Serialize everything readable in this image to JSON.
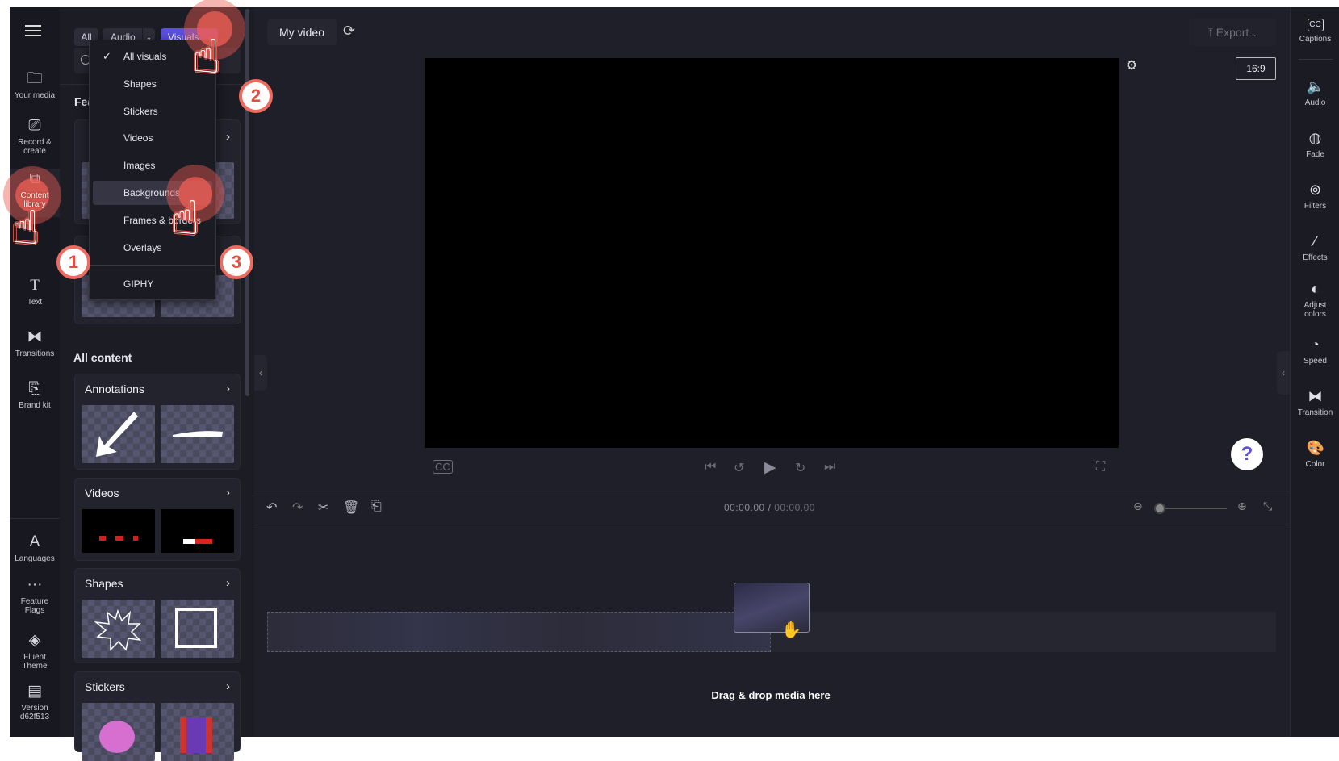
{
  "left_nav": {
    "items": [
      {
        "label": "Your media",
        "icon": "folder-icon"
      },
      {
        "label": "Record & create",
        "icon": "camera-icon"
      },
      {
        "label": "Content library",
        "icon": "content-library-icon"
      },
      {
        "label": "Text",
        "icon": "text-icon"
      },
      {
        "label": "Transitions",
        "icon": "transitions-icon"
      },
      {
        "label": "Brand kit",
        "icon": "brand-kit-icon"
      },
      {
        "label": "Languages",
        "icon": "languages-icon"
      },
      {
        "label": "Feature Flags",
        "icon": "more-icon"
      },
      {
        "label": "Fluent Theme",
        "icon": "paint-bucket-icon"
      },
      {
        "label": "Version d62f513",
        "icon": "archive-icon"
      }
    ]
  },
  "library": {
    "filters": {
      "all": "All",
      "audio": "Audio",
      "visuals": "Visuals"
    },
    "featured_heading": "Fea",
    "all_content_heading": "All content",
    "categories": [
      "Annotations",
      "Videos",
      "Shapes",
      "Stickers"
    ],
    "dropdown": {
      "items": [
        "All visuals",
        "Shapes",
        "Stickers",
        "Videos",
        "Images",
        "Backgrounds",
        "Frames & borders",
        "Overlays",
        "GIPHY"
      ],
      "selected": "All visuals",
      "hovered": "Backgrounds"
    }
  },
  "header": {
    "project_name": "My video",
    "export_label": "Export",
    "aspect_ratio": "16:9"
  },
  "timeline": {
    "current_time": "00:00.00",
    "separator": "/",
    "total_time": "00:00.00",
    "drop_hint": "Drag & drop media here"
  },
  "right_bar": {
    "items": [
      {
        "label": "Captions",
        "icon": "captions-icon"
      },
      {
        "label": "Audio",
        "icon": "speaker-icon"
      },
      {
        "label": "Fade",
        "icon": "fade-icon"
      },
      {
        "label": "Filters",
        "icon": "filters-icon"
      },
      {
        "label": "Effects",
        "icon": "magic-wand-icon"
      },
      {
        "label": "Adjust colors",
        "icon": "contrast-icon"
      },
      {
        "label": "Speed",
        "icon": "speedometer-icon"
      },
      {
        "label": "Transition",
        "icon": "transition-icon"
      },
      {
        "label": "Color",
        "icon": "palette-icon"
      }
    ]
  },
  "help": {
    "label": "?"
  },
  "annotations": {
    "steps": [
      "1",
      "2",
      "3"
    ],
    "accent": "#e9584c"
  },
  "colors": {
    "accent": "#5b4fe0",
    "background": "#1f1f29"
  }
}
